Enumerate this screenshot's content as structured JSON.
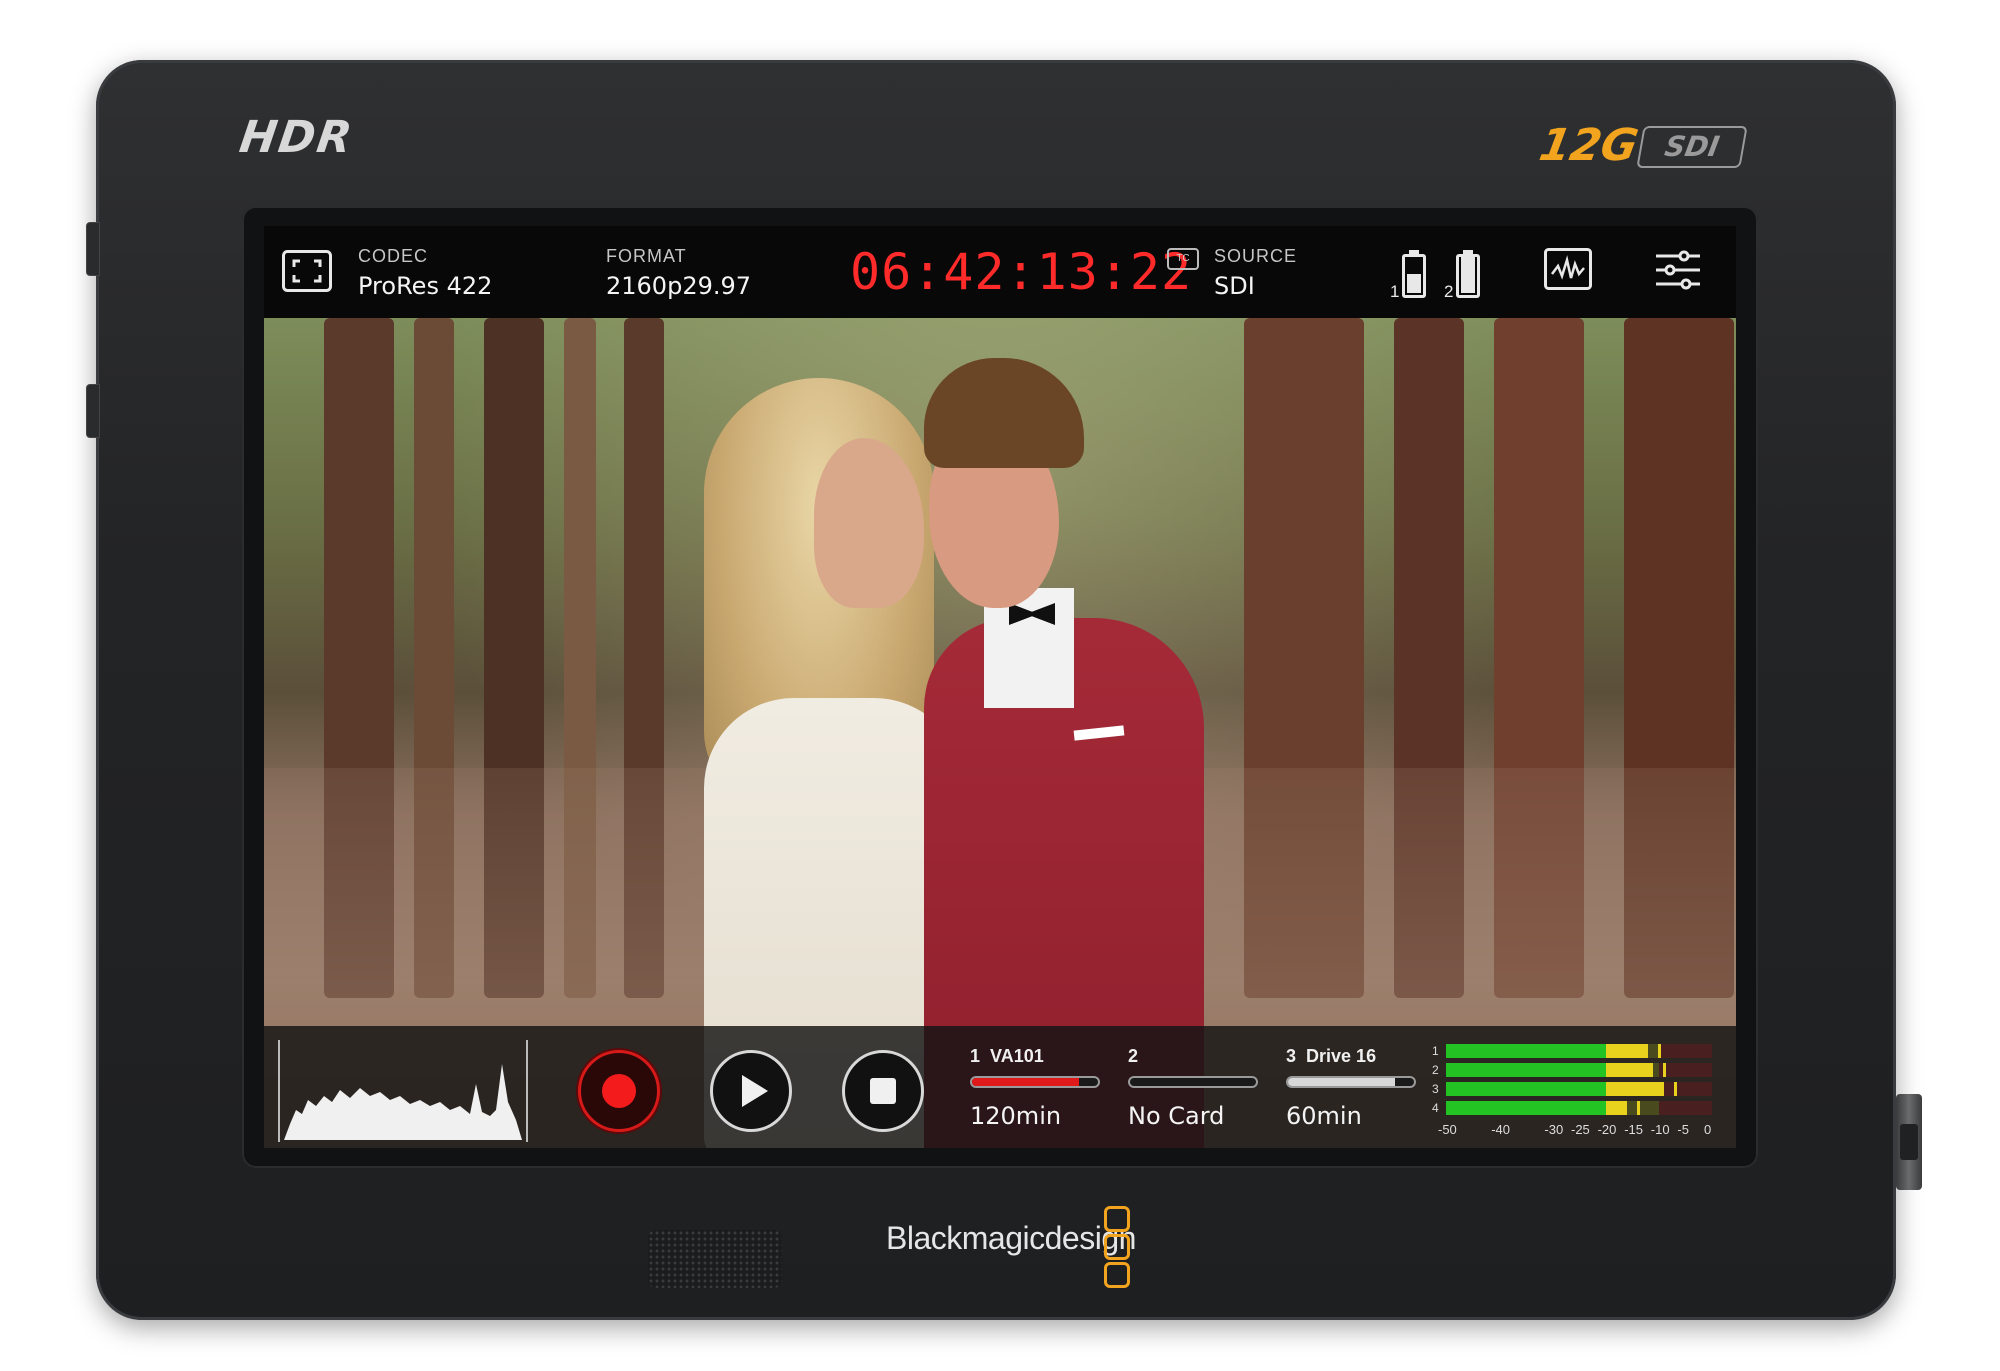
{
  "device": {
    "hdr_logo": "HDR",
    "sdi_logo_number": "12G",
    "sdi_logo_text": "SDI",
    "brand_name": "Blackmagicdesign",
    "accent_color": "#f2a41e"
  },
  "topbar": {
    "codec_label": "CODEC",
    "codec_value": "ProRes 422",
    "format_label": "FORMAT",
    "format_value": "2160p29.97",
    "timecode": "06:42:13:22",
    "timecode_color": "#ff2a2a",
    "tc_badge": "TC",
    "source_label": "SOURCE",
    "source_value": "SDI",
    "batteries": [
      {
        "label": "1",
        "level": 0.5
      },
      {
        "label": "2",
        "level": 0.95
      }
    ],
    "icons": [
      "fullscreen-icon",
      "battery-icon",
      "waveform-scope-icon",
      "settings-sliders-icon"
    ]
  },
  "transport": {
    "buttons": [
      "record-button",
      "play-button",
      "stop-button"
    ],
    "record_color": "#f31b1b"
  },
  "slots": [
    {
      "number": "1",
      "name": "VA101",
      "remaining": "120min",
      "fill": 0.85,
      "color": "#e01a1a"
    },
    {
      "number": "2",
      "name": "",
      "remaining": "No Card",
      "fill": 0.0,
      "color": "#9a9a9a"
    },
    {
      "number": "3",
      "name": "Drive 16",
      "remaining": "60min",
      "fill": 0.85,
      "color": "#d8d8d8"
    }
  ],
  "audio_meters": {
    "channels": [
      "1",
      "2",
      "3",
      "4"
    ],
    "levels_db": [
      -12,
      -11,
      -9,
      -16
    ],
    "scale": [
      "-50",
      "-40",
      "-30",
      "-25",
      "-20",
      "-15",
      "-10",
      "-5",
      "0"
    ]
  }
}
